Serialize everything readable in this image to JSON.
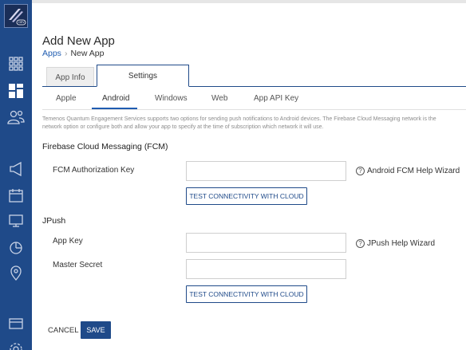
{
  "header": {
    "title": "Add New App",
    "breadcrumb": [
      {
        "label": "Apps"
      },
      {
        "label": "New App"
      }
    ]
  },
  "tabs": [
    {
      "label": "App Info",
      "active": false
    },
    {
      "label": "Settings",
      "active": true
    }
  ],
  "subtabs": [
    {
      "label": "Apple"
    },
    {
      "label": "Android",
      "active": true
    },
    {
      "label": "Windows"
    },
    {
      "label": "Web"
    },
    {
      "label": "App API Key"
    }
  ],
  "description": {
    "line1": "Temenos Quantum Engagement Services supports two options for sending push notifications to Android devices. The Firebase Cloud Messaging network is the",
    "line2": "network option or configure both and allow your app to specify at the time of subscription which network it will use."
  },
  "fcm": {
    "title": "Firebase Cloud Messaging (FCM)",
    "auth_key_label": "FCM Authorization Key",
    "auth_key_value": "",
    "help_label": "Android FCM Help Wizard",
    "test_button": "TEST CONNECTIVITY WITH CLOUD"
  },
  "jpush": {
    "title": "JPush",
    "app_key_label": "App Key",
    "app_key_value": "",
    "master_secret_label": "Master Secret",
    "master_secret_value": "",
    "help_label": "JPush Help Wizard",
    "test_button": "TEST CONNECTIVITY WITH CLOUD"
  },
  "footer": {
    "cancel_label": "CANCEL",
    "save_label": "SAVE"
  },
  "sidebar": {
    "logo_badge": "DEV",
    "items": [
      {
        "icon": "apps-grid-icon"
      },
      {
        "icon": "dashboard-icon",
        "active": true
      },
      {
        "icon": "users-icon"
      },
      {
        "icon": "megaphone-icon"
      },
      {
        "icon": "calendar-icon"
      },
      {
        "icon": "monitor-icon"
      },
      {
        "icon": "pie-chart-icon"
      },
      {
        "icon": "location-pin-icon"
      },
      {
        "icon": "window-icon"
      },
      {
        "icon": "settings-gear-icon"
      }
    ]
  },
  "colors": {
    "sidebar": "#1f4a89",
    "accent": "#1f5cb0",
    "primary_button": "#1f4a89"
  }
}
